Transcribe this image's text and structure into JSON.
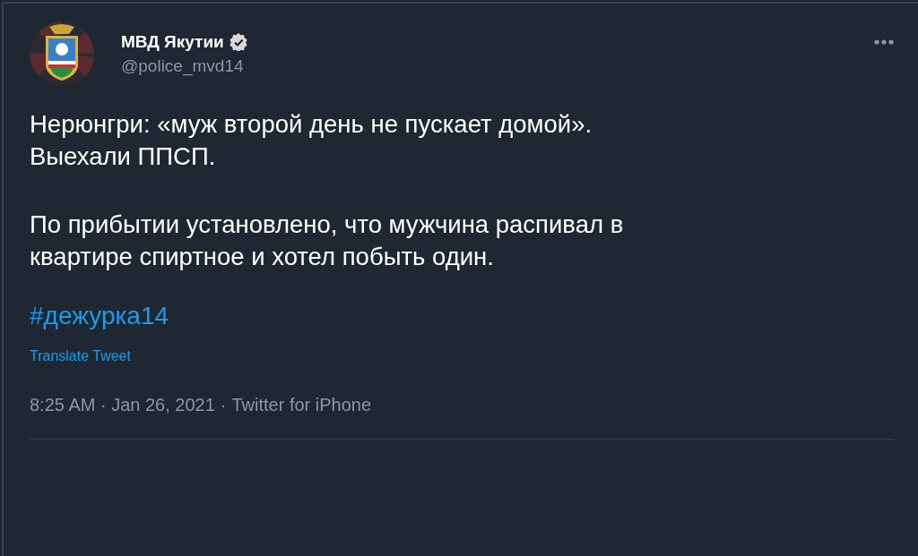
{
  "author": {
    "name": "МВД Якутии",
    "verified": true,
    "handle": "@police_mvd14"
  },
  "paragraphs": [
    "Нерюнгри: «муж второй день не пускает домой».\nВыехали ППСП.",
    "По прибытии установлено, что мужчина распивал в\nквартире спиртное и хотел побыть один."
  ],
  "hashtag": "#дежурка14",
  "translate": "Translate Tweet",
  "timestamp": "8:25 AM · Jan 26, 2021",
  "separator": "·",
  "source": "Twitter for iPhone"
}
